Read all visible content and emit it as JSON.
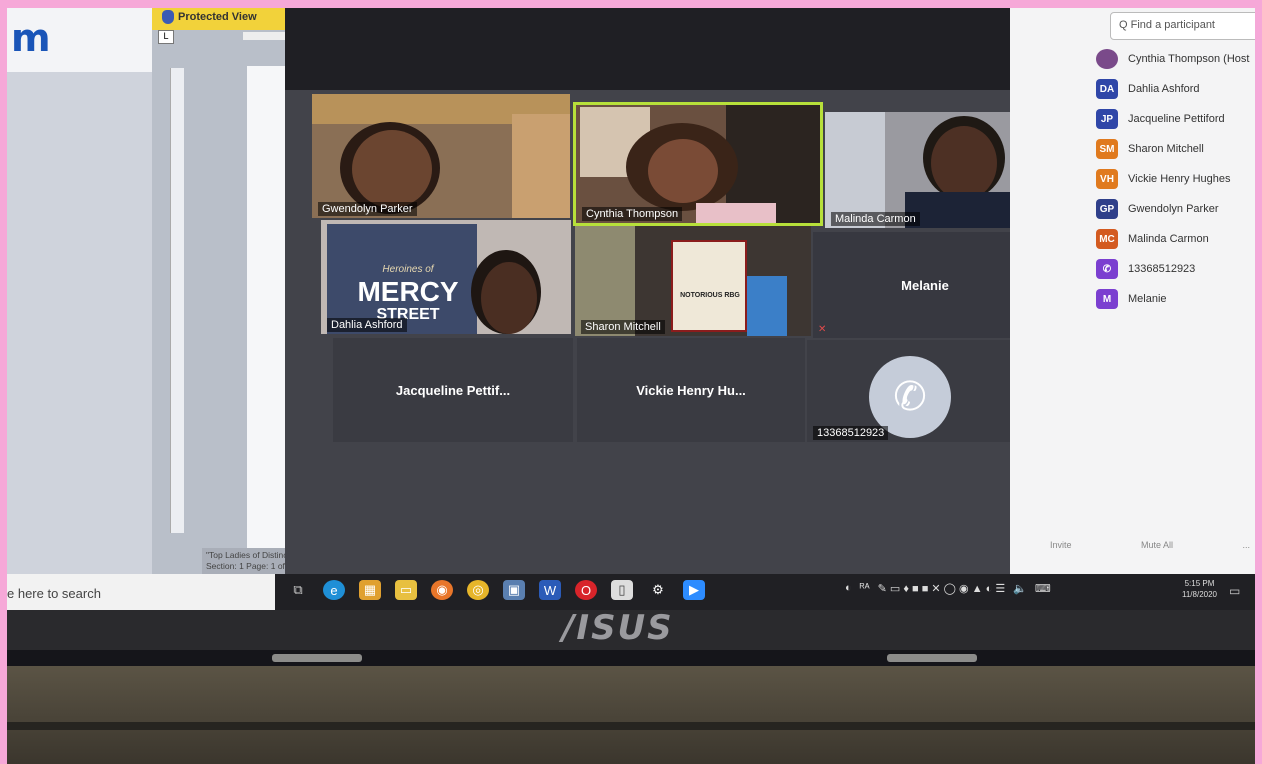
{
  "doc": {
    "logo_text": "m",
    "protected_view": "Protected View",
    "ruler_box": "L",
    "status_line1": "\"Top Ladies of Distinc",
    "status_line2": "Section: 1    Page: 1 of"
  },
  "zoom": {
    "tiles": [
      {
        "name": "Gwendolyn Parker"
      },
      {
        "name": "Cynthia Thompson"
      },
      {
        "name": "Malinda Carmon"
      },
      {
        "name": "Dahlia Ashford",
        "book_title": "Heroines of",
        "book_title2": "MERCY",
        "book_title3": "STREET"
      },
      {
        "name": "Sharon Mitchell",
        "book_text": "NOTORIOUS RBG"
      },
      {
        "name": "Melanie"
      },
      {
        "name": "Jacqueline Pettif..."
      },
      {
        "name": "Vickie Henry Hu..."
      },
      {
        "name": "13368512923"
      }
    ]
  },
  "panel": {
    "search_placeholder": "Q Find a participant",
    "participants": [
      {
        "initials": "",
        "name": "Cynthia Thompson (Host",
        "color": "#7a4a8a"
      },
      {
        "initials": "DA",
        "name": "Dahlia Ashford",
        "color": "#2f46a8"
      },
      {
        "initials": "JP",
        "name": "Jacqueline Pettiford",
        "color": "#2f46a8"
      },
      {
        "initials": "SM",
        "name": "Sharon Mitchell",
        "color": "#e07a1e"
      },
      {
        "initials": "VH",
        "name": "Vickie Henry Hughes",
        "color": "#e07a1e"
      },
      {
        "initials": "GP",
        "name": "Gwendolyn Parker",
        "color": "#2f3f8a"
      },
      {
        "initials": "MC",
        "name": "Malinda Carmon",
        "color": "#d35a20"
      },
      {
        "initials": "",
        "name": "13368512923",
        "color": "#7b3fd0"
      },
      {
        "initials": "M",
        "name": "Melanie",
        "color": "#7b3fd0"
      }
    ],
    "invite": "Invite",
    "mute_all": "Mute All",
    "more": "..."
  },
  "taskbar": {
    "search_text": "e here to search",
    "time": "5:15 PM",
    "date": "11/8/2020"
  },
  "laptop": {
    "brand": "/ISUS"
  }
}
